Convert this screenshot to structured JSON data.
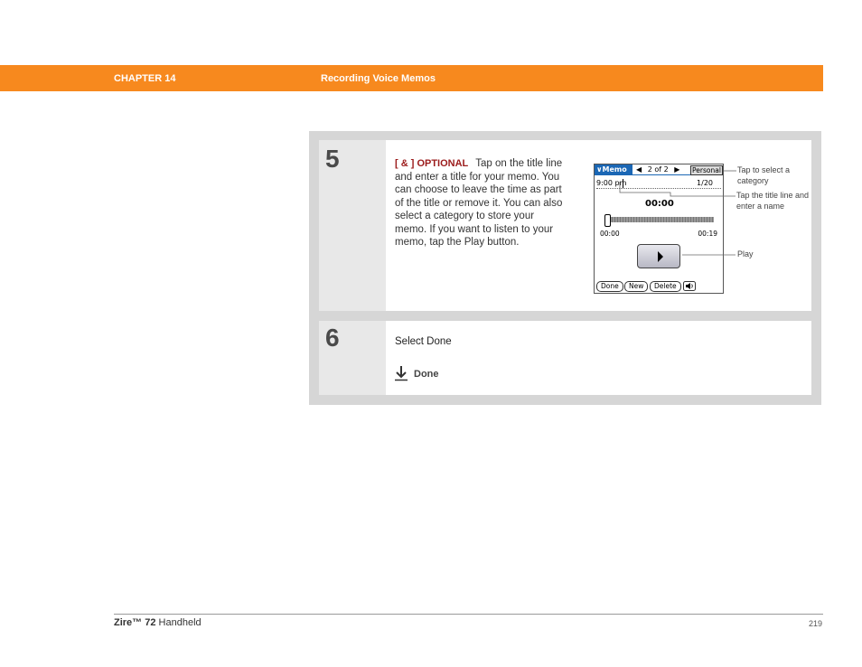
{
  "header": {
    "chapter": "CHAPTER 14",
    "section": "Recording Voice Memos"
  },
  "steps": [
    {
      "number": "5",
      "tag": "[ & ]  OPTIONAL",
      "text": "Tap on the title line and enter a title for your memo. You can choose to leave the time as part of the title or remove it. You can also select a category to store your memo. If you want to listen to your memo, tap the Play button."
    },
    {
      "number": "6",
      "text": "Select Done",
      "action_label": "Done"
    }
  ],
  "device": {
    "app_title": "Memo",
    "app_title_prefix": "∨",
    "nav_text": "2 of 2",
    "category": "Personal",
    "memo_time": "9:00 pm",
    "memo_count": "1/20",
    "clock": "00:00",
    "slider_start": "00:00",
    "slider_end": "00:19",
    "slider_position": 0,
    "buttons": [
      "Done",
      "New",
      "Delete"
    ]
  },
  "callouts": {
    "category": "Tap to select a category",
    "title_line": "Tap the title line and enter a name",
    "play": "Play"
  },
  "footer": {
    "product_brand": "Zire™ 72",
    "product_suffix": "Handheld",
    "page_number": "219"
  },
  "colors": {
    "header_orange": "#f7891e",
    "optional_red": "#9b1b1b",
    "device_blue": "#1b67b5"
  }
}
